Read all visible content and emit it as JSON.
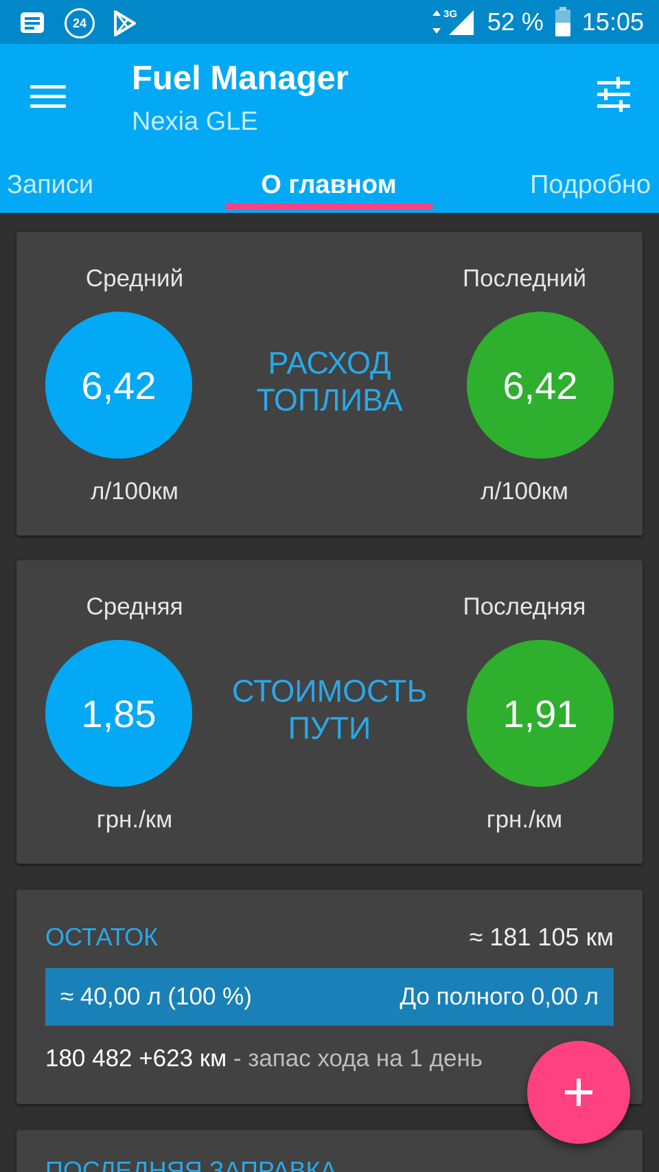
{
  "status_bar": {
    "notification_badge": "24",
    "network": "3G",
    "battery": "52 %",
    "time": "15:05"
  },
  "app_bar": {
    "title": "Fuel Manager",
    "subtitle": "Nexia GLE"
  },
  "tabs": [
    {
      "label": "Записи",
      "active": false
    },
    {
      "label": "О главном",
      "active": true
    },
    {
      "label": "Подробно",
      "active": false
    }
  ],
  "consumption_card": {
    "title_line1": "РАСХОД",
    "title_line2": "ТОПЛИВА",
    "average": {
      "label": "Средний",
      "value": "6,42",
      "unit": "л/100км"
    },
    "last": {
      "label": "Последний",
      "value": "6,42",
      "unit": "л/100км"
    }
  },
  "cost_card": {
    "title_line1": "СТОИМОСТЬ",
    "title_line2": "ПУТИ",
    "average": {
      "label": "Средняя",
      "value": "1,85",
      "unit": "грн./км"
    },
    "last": {
      "label": "Последняя",
      "value": "1,91",
      "unit": "грн./км"
    }
  },
  "remainder_card": {
    "title": "ОСТАТОК",
    "odometer": "≈ 181 105 км",
    "fuel_level": "≈ 40,00 л (100 %)",
    "fuel_fraction": 1.0,
    "to_full": "До полного 0,00 л",
    "range_value": "180 482 +623 км",
    "range_note": " - запас хода на 1 день"
  },
  "last_fill_card": {
    "title": "ПОСЛЕДНЯЯ ЗАПРАВКА"
  },
  "colors": {
    "primary": "#03a9f4",
    "primary_dark": "#0288c9",
    "accent": "#ff4081",
    "green": "#2eaf2e",
    "card": "#424242",
    "background": "#303030"
  },
  "icons": {
    "menu": "menu-icon",
    "tune": "tune-icon",
    "add": "add-icon"
  }
}
